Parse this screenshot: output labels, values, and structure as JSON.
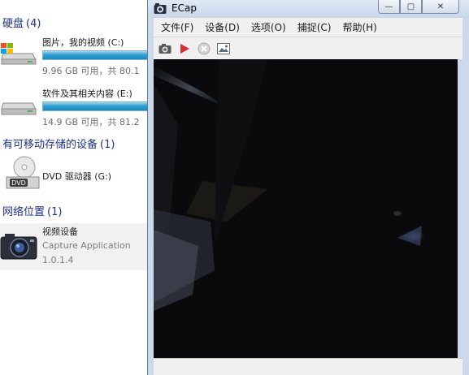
{
  "explorer": {
    "hard_disks": {
      "title": "硬盘",
      "count": "(4)"
    },
    "drives": [
      {
        "label": "图片，我的视频 (C:)",
        "space": "9.96 GB 可用，共 80.1"
      },
      {
        "label": "软件及其相关内容 (E:)",
        "space": "14.9 GB 可用，共 81.2"
      }
    ],
    "removable": {
      "title": "有可移动存储的设备",
      "count": "(1)"
    },
    "dvd": {
      "label": "DVD 驱动器 (G:)",
      "icon_text": "DVD"
    },
    "network": {
      "title": "网络位置",
      "count": "(1)"
    },
    "video_device": {
      "name": "视频设备",
      "description": "Capture Application",
      "version": "1.0.1.4"
    }
  },
  "ecap": {
    "title": "ECap",
    "window_buttons": {
      "minimize": "—",
      "maximize": "▢",
      "close": "✕"
    },
    "menu": [
      {
        "label": "文件(F)"
      },
      {
        "label": "设备(D)"
      },
      {
        "label": "选项(O)"
      },
      {
        "label": "捕捉(C)"
      },
      {
        "label": "帮助(H)"
      }
    ],
    "toolbar": [
      "camera-icon",
      "play-icon",
      "stop-icon",
      "image-icon"
    ]
  },
  "colors": {
    "section_header": "#1e3287",
    "window_chrome": "#ccd9ea",
    "drive_bar": "#2ea0d1",
    "play": "#d0302f"
  }
}
